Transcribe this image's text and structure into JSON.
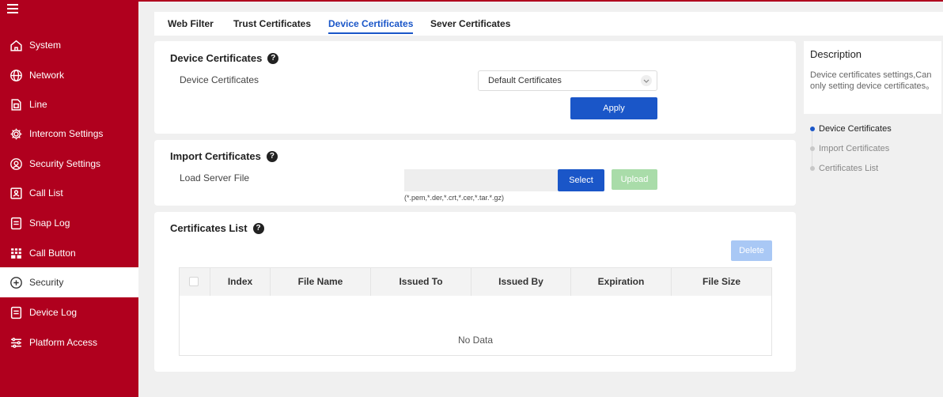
{
  "sidebar": {
    "items": [
      {
        "label": "System",
        "icon": "home-icon"
      },
      {
        "label": "Network",
        "icon": "globe-icon"
      },
      {
        "label": "Line",
        "icon": "sim-card-icon"
      },
      {
        "label": "Intercom Settings",
        "icon": "gear-icon"
      },
      {
        "label": "Security Settings",
        "icon": "security-camera-icon"
      },
      {
        "label": "Call List",
        "icon": "call-list-icon"
      },
      {
        "label": "Snap Log",
        "icon": "document-icon"
      },
      {
        "label": "Call Button",
        "icon": "grid-button-icon"
      },
      {
        "label": "Security",
        "icon": "shield-plus-icon"
      },
      {
        "label": "Device Log",
        "icon": "document-icon"
      },
      {
        "label": "Platform Access",
        "icon": "sliders-icon"
      }
    ],
    "active_index": 8
  },
  "tabs": [
    "Web Filter",
    "Trust Certificates",
    "Device Certificates",
    "Sever Certificates"
  ],
  "device_certificates": {
    "title": "Device Certificates",
    "field_label": "Device Certificates",
    "select_value": "Default Certificates",
    "apply_label": "Apply"
  },
  "import_certificates": {
    "title": "Import Certificates",
    "field_label": "Load Server File",
    "select_label": "Select",
    "upload_label": "Upload",
    "hint": "(*.pem,*.der,*.crt,*.cer,*.tar.*.gz)"
  },
  "certificates_list": {
    "title": "Certificates List",
    "delete_label": "Delete",
    "columns": [
      "Index",
      "File Name",
      "Issued To",
      "Issued By",
      "Expiration",
      "File Size"
    ],
    "rows": [],
    "empty_text": "No Data"
  },
  "description": {
    "title": "Description",
    "text": "Device certificates settings,Can only setting device certificates。",
    "anchors": [
      "Device Certificates",
      "Import Certificates",
      "Certificates List"
    ]
  },
  "colors": {
    "brand_red": "#b0001e",
    "primary_blue": "#1a56c8",
    "upload_disabled": "#a9dca9",
    "delete_disabled": "#a9c8f5"
  }
}
